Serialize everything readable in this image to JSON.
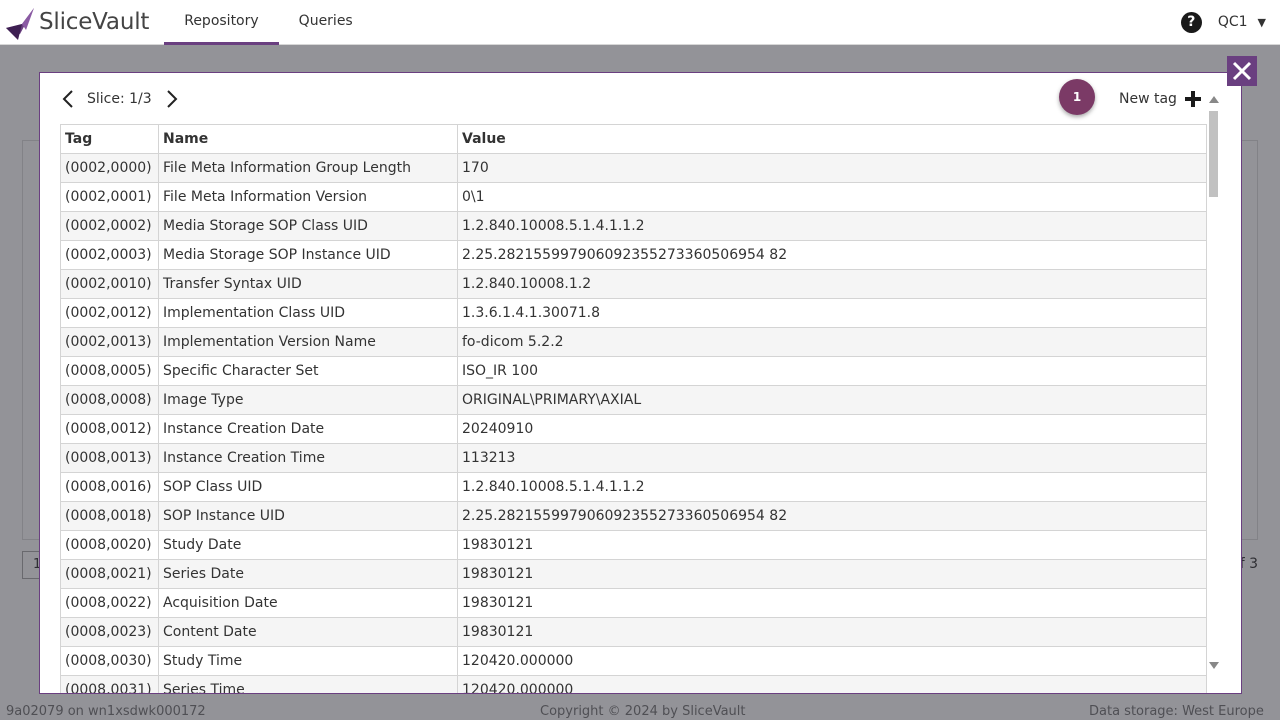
{
  "app": {
    "name": "SliceVault"
  },
  "nav": {
    "items": [
      {
        "label": "Repository"
      },
      {
        "label": "Queries"
      }
    ]
  },
  "user": {
    "name": "QC1"
  },
  "colors": {
    "brand": "#6a3f80",
    "badge": "#7b3a66"
  },
  "background": {
    "pager": "1",
    "page_info": "f 3",
    "footer": {
      "left": "9a02079 on wn1xsdwk000172",
      "center": "Copyright © 2024 by SliceVault",
      "right": "Data storage: West Europe"
    }
  },
  "modal": {
    "slice_label": "Slice: 1/3",
    "badge_count": "1",
    "new_tag_label": "New tag",
    "columns": [
      "Tag",
      "Name",
      "Value"
    ],
    "rows": [
      [
        "(0002,0000)",
        "File Meta Information Group Length",
        "170"
      ],
      [
        "(0002,0001)",
        "File Meta Information Version",
        "0\\1"
      ],
      [
        "(0002,0002)",
        "Media Storage SOP Class UID",
        "1.2.840.10008.5.1.4.1.1.2"
      ],
      [
        "(0002,0003)",
        "Media Storage SOP Instance UID",
        "2.25.282155997906092355273360506954 82"
      ],
      [
        "(0002,0010)",
        "Transfer Syntax UID",
        "1.2.840.10008.1.2"
      ],
      [
        "(0002,0012)",
        "Implementation Class UID",
        "1.3.6.1.4.1.30071.8"
      ],
      [
        "(0002,0013)",
        "Implementation Version Name",
        "fo-dicom 5.2.2"
      ],
      [
        "(0008,0005)",
        "Specific Character Set",
        "ISO_IR 100"
      ],
      [
        "(0008,0008)",
        "Image Type",
        "ORIGINAL\\PRIMARY\\AXIAL"
      ],
      [
        "(0008,0012)",
        "Instance Creation Date",
        "20240910"
      ],
      [
        "(0008,0013)",
        "Instance Creation Time",
        "113213"
      ],
      [
        "(0008,0016)",
        "SOP Class UID",
        "1.2.840.10008.5.1.4.1.1.2"
      ],
      [
        "(0008,0018)",
        "SOP Instance UID",
        "2.25.282155997906092355273360506954 82"
      ],
      [
        "(0008,0020)",
        "Study Date",
        "19830121"
      ],
      [
        "(0008,0021)",
        "Series Date",
        "19830121"
      ],
      [
        "(0008,0022)",
        "Acquisition Date",
        "19830121"
      ],
      [
        "(0008,0023)",
        "Content Date",
        "19830121"
      ],
      [
        "(0008,0030)",
        "Study Time",
        "120420.000000"
      ],
      [
        "(0008,0031)",
        "Series Time",
        "120420.000000"
      ]
    ]
  }
}
